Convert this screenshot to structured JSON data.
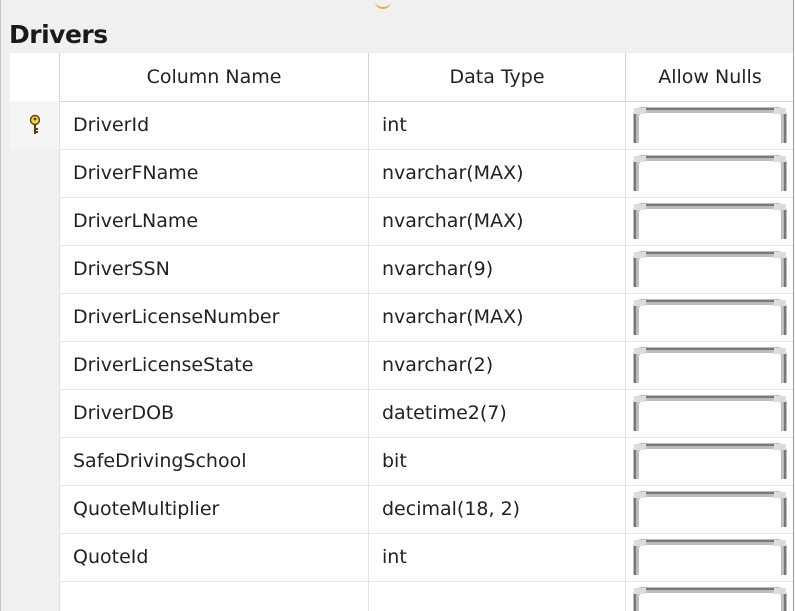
{
  "table": {
    "name": "Drivers"
  },
  "columns_header": {
    "column_name": "Column Name",
    "data_type": "Data Type",
    "allow_nulls": "Allow Nulls"
  },
  "rows": [
    {
      "name": "DriverId",
      "type": "int",
      "primary_key": true
    },
    {
      "name": "DriverFName",
      "type": "nvarchar(MAX)",
      "primary_key": false
    },
    {
      "name": "DriverLName",
      "type": "nvarchar(MAX)",
      "primary_key": false
    },
    {
      "name": "DriverSSN",
      "type": "nvarchar(9)",
      "primary_key": false
    },
    {
      "name": "DriverLicenseNumber",
      "type": "nvarchar(MAX)",
      "primary_key": false
    },
    {
      "name": "DriverLicenseState",
      "type": "nvarchar(2)",
      "primary_key": false
    },
    {
      "name": "DriverDOB",
      "type": "datetime2(7)",
      "primary_key": false
    },
    {
      "name": "SafeDrivingSchool",
      "type": "bit",
      "primary_key": false
    },
    {
      "name": "QuoteMultiplier",
      "type": "decimal(18, 2)",
      "primary_key": false
    },
    {
      "name": "QuoteId",
      "type": "int",
      "primary_key": false
    },
    {
      "name": "",
      "type": "",
      "primary_key": false
    }
  ],
  "icons": {
    "primary_key": "key-icon",
    "allow_nulls_checkbox": "checkbox-icon"
  }
}
